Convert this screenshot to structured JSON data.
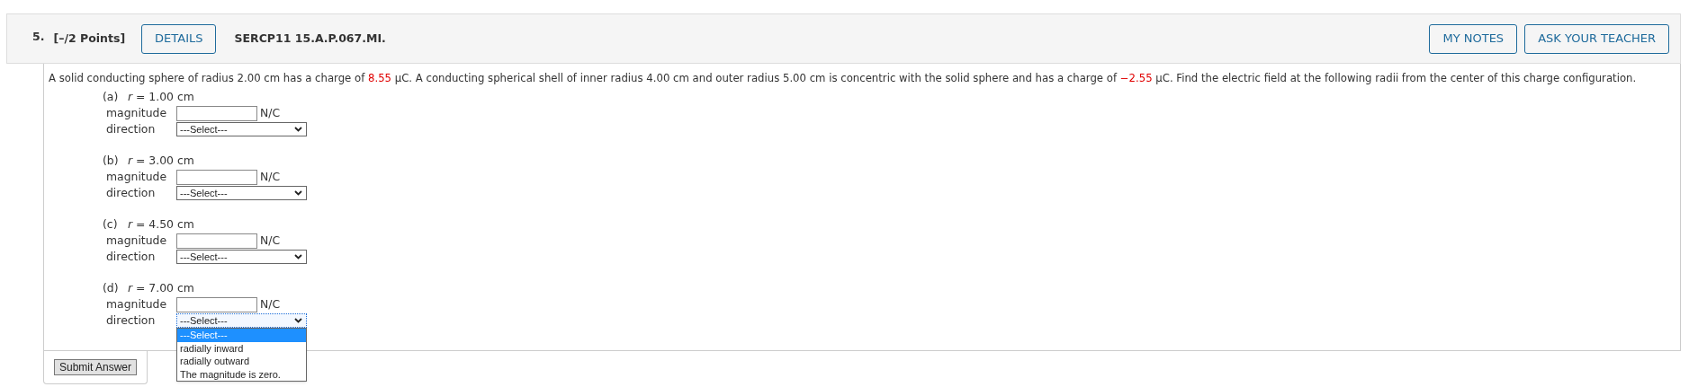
{
  "header": {
    "number": "5.",
    "points": "[–/2 Points]",
    "details_button": "DETAILS",
    "code": "SERCP11 15.A.P.067.MI.",
    "buttons": [
      "MY NOTES",
      "ASK YOUR TEACHER"
    ]
  },
  "question": [
    {
      "kind": "plain",
      "text": "A solid conducting sphere of radius 2.00 cm has a charge of "
    },
    {
      "kind": "value",
      "text": "8.55"
    },
    {
      "kind": "plain",
      "text": " μC. A conducting spherical shell of inner radius 4.00 cm and outer radius 5.00 cm is concentric with the solid sphere and has a charge of "
    },
    {
      "kind": "value",
      "text": "−2.55"
    },
    {
      "kind": "plain",
      "text": " μC. Find the electric field at the following radii from the center of this charge configuration."
    }
  ],
  "parts": [
    {
      "label": "(a)",
      "radius": "*r* = 1.00 cm",
      "magnitude_label": "magnitude",
      "unit": "N/C",
      "direction_label": "direction",
      "direction": "---Select---",
      "expanded": false
    },
    {
      "label": "(b)",
      "radius": "*r* = 3.00 cm",
      "magnitude_label": "magnitude",
      "unit": "N/C",
      "direction_label": "direction",
      "direction": "---Select---",
      "expanded": false
    },
    {
      "label": "(c)",
      "radius": "*r* = 4.50 cm",
      "magnitude_label": "magnitude",
      "unit": "N/C",
      "direction_label": "direction",
      "direction": "---Select---",
      "expanded": false
    },
    {
      "label": "(d)",
      "radius": "*r* = 7.00 cm",
      "magnitude_label": "magnitude",
      "unit": "N/C",
      "direction_label": "direction",
      "direction": "---Select---",
      "expanded": true,
      "options": [
        {
          "text": "---Select---",
          "selected": true
        },
        {
          "text": "radially inward",
          "selected": false
        },
        {
          "text": "radially outward",
          "selected": false
        },
        {
          "text": "The magnitude is zero.",
          "selected": false
        }
      ]
    }
  ],
  "submit_button": "Submit Answer"
}
